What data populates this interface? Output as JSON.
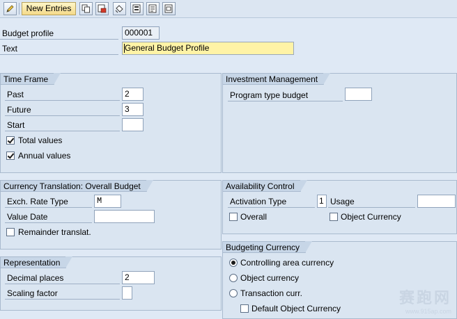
{
  "toolbar": {
    "new_entries_label": "New Entries",
    "icons": [
      "pencil-glasses-icon",
      "copy-icon",
      "delete-icon",
      "undo-icon",
      "select-all-icon",
      "select-block-icon",
      "deselect-icon"
    ]
  },
  "header": {
    "budget_profile_label": "Budget profile",
    "budget_profile_value": "000001",
    "text_label": "Text",
    "text_value": "General Budget Profile"
  },
  "time_frame": {
    "title": "Time Frame",
    "past_label": "Past",
    "past_value": "2",
    "future_label": "Future",
    "future_value": "3",
    "start_label": "Start",
    "start_value": "",
    "total_values_label": "Total values",
    "total_values_checked": true,
    "annual_values_label": "Annual values",
    "annual_values_checked": true
  },
  "investment": {
    "title": "Investment Management",
    "program_type_label": "Program type budget",
    "program_type_value": ""
  },
  "currency_translation": {
    "title": "Currency Translation: Overall Budget",
    "exch_rate_label": "Exch. Rate Type",
    "exch_rate_value": "M",
    "value_date_label": "Value Date",
    "value_date_value": "",
    "remainder_label": "Remainder translat.",
    "remainder_checked": false
  },
  "availability": {
    "title": "Availability Control",
    "activation_type_label": "Activation Type",
    "activation_type_value": "1",
    "usage_label": "Usage",
    "usage_value": "",
    "overall_label": "Overall",
    "object_currency_label": "Object Currency"
  },
  "representation": {
    "title": "Representation",
    "decimal_label": "Decimal places",
    "decimal_value": "2",
    "scaling_label": "Scaling factor",
    "scaling_value": ""
  },
  "budgeting_currency": {
    "title": "Budgeting Currency",
    "options": [
      "Controlling area currency",
      "Object currency",
      "Transaction curr."
    ],
    "selected": 0,
    "default_object_label": "Default Object Currency"
  },
  "watermark": {
    "main": "赛跑网",
    "sub": "www.915ap.com"
  },
  "colors": {
    "accent_yellow": "#fff3a6",
    "group_bg": "#dae5f1",
    "title_bg": "#c7d6e7"
  }
}
